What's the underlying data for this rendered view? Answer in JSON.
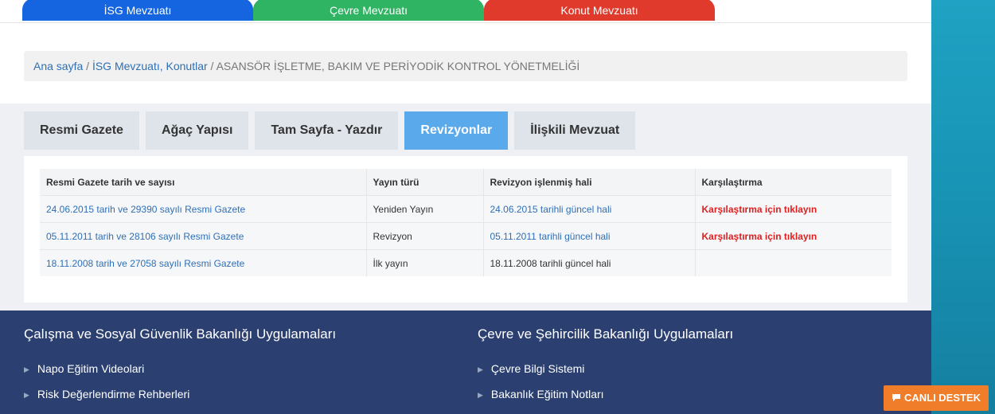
{
  "top_tabs": [
    "İSG Mevzuatı",
    "Çevre Mevzuatı",
    "Konut Mevzuatı"
  ],
  "breadcrumb": {
    "home": "Ana sayfa",
    "sep1": " / ",
    "section": "İSG Mevzuatı, Konutlar",
    "sep2": " / ",
    "current": "ASANSÖR İŞLETME, BAKIM VE PERİYODİK KONTROL YÖNETMELİĞİ"
  },
  "tabs": [
    "Resmi Gazete",
    "Ağaç Yapısı",
    "Tam Sayfa - Yazdır",
    "Revizyonlar",
    "İlişkili Mevzuat"
  ],
  "active_tab": "Revizyonlar",
  "table": {
    "headers": [
      "Resmi Gazete tarih ve sayısı",
      "Yayın türü",
      "Revizyon işlenmiş hali",
      "Karşılaştırma"
    ],
    "rows": [
      [
        "24.06.2015 tarih ve 29390 sayılı Resmi Gazete",
        "Yeniden Yayın",
        "24.06.2015 tarihli güncel hali",
        "Karşılaştırma için tıklayın"
      ],
      [
        "05.11.2011 tarih ve 28106 sayılı Resmi Gazete",
        "Revizyon",
        "05.11.2011 tarihli güncel hali",
        "Karşılaştırma için tıklayın"
      ],
      [
        "18.11.2008 tarih ve 27058 sayılı Resmi Gazete",
        "İlk yayın",
        "18.11.2008 tarihli güncel hali",
        ""
      ]
    ]
  },
  "footer": {
    "left_title": "Çalışma ve Sosyal Güvenlik Bakanlığı Uygulamaları",
    "left_items": [
      "Napo Eğitim Videolari",
      "Risk Değerlendirme Rehberleri"
    ],
    "right_title": "Çevre ve Şehircilik Bakanlığı Uygulamaları",
    "right_items": [
      "Çevre Bilgi Sistemi",
      "Bakanlık Eğitim Notları"
    ]
  },
  "chat_label": "CANLI DESTEK",
  "colors": {
    "isg_blue": "#1565e0",
    "cevre_green": "#2fb463",
    "konut_red": "#e03a2c",
    "active_tab": "#5aa9ea",
    "footer_bg": "#2b4070",
    "chat_orange": "#ef7d2a"
  },
  "icons": {
    "chat": "chat-bubble-icon",
    "list_bullet": "triangle-right-icon"
  }
}
